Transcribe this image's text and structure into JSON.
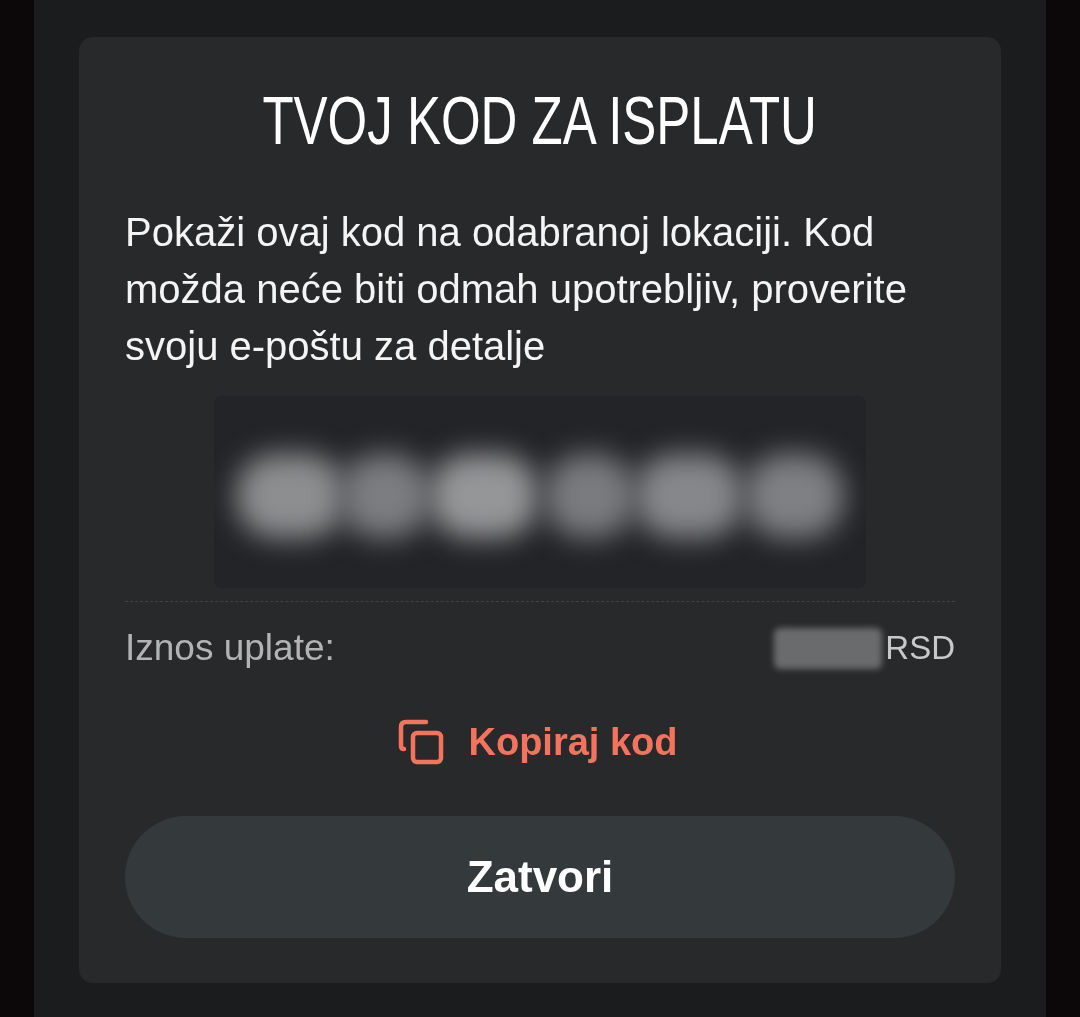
{
  "dialog": {
    "title": "TVOJ KOD ZA ISPLATU",
    "message": "Pokaži ovaj kod na odabranoj lokaciji. Kod možda neće biti odmah upotrebljiv, proverite svoju e-poštu za detalje",
    "amount": {
      "label": "Iznos uplate:",
      "currency": "RSD"
    },
    "copy_action": {
      "label": "Kopiraj kod"
    },
    "close_button": {
      "label": "Zatvori"
    }
  }
}
